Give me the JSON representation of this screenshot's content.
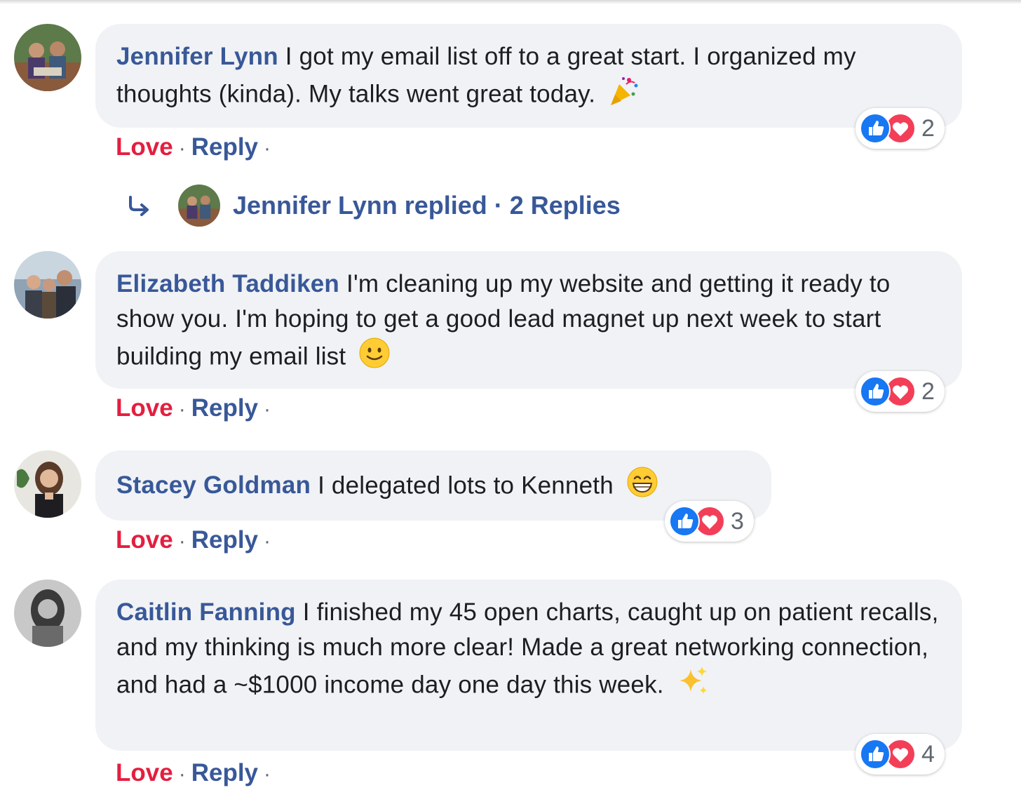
{
  "comments": [
    {
      "author": "Jennifer Lynn",
      "text": "I got my email list off to a great start. I organized my thoughts (kinda). My talks went great today.",
      "emoji": "party-popper",
      "reaction_count": "2",
      "actions": {
        "love": "Love",
        "reply": "Reply",
        "sep": "·"
      }
    },
    {
      "author": "Elizabeth Taddiken",
      "text": "I'm cleaning up my website and getting it ready to show you. I'm hoping to get a good lead magnet up next week to start building my email list",
      "emoji": "smiling-face",
      "reaction_count": "2",
      "actions": {
        "love": "Love",
        "reply": "Reply",
        "sep": "·"
      }
    },
    {
      "author": "Stacey Goldman",
      "text": "I delegated lots to Kenneth",
      "emoji": "grinning-face",
      "reaction_count": "3",
      "actions": {
        "love": "Love",
        "reply": "Reply",
        "sep": "·"
      }
    },
    {
      "author": "Caitlin Fanning",
      "text": "I finished my 45 open charts, caught up on patient recalls, and my thinking is much more clear! Made a great networking connection, and had a ~$1000 income day one day this week.",
      "emoji": "sparkles",
      "reaction_count": "4",
      "actions": {
        "love": "Love",
        "reply": "Reply",
        "sep": "·"
      }
    }
  ],
  "replies_summary": {
    "text": "Jennifer Lynn replied · 2 Replies"
  },
  "colors": {
    "author": "#385898",
    "love": "#e41e3f",
    "bubble": "#f0f2f5",
    "like_icon": "#1877f2",
    "love_icon": "#f33e58"
  }
}
